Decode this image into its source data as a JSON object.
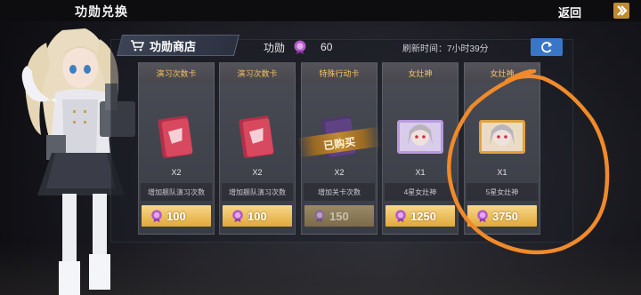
{
  "header": {
    "title": "功勋兑换",
    "back_label": "返回"
  },
  "shop": {
    "tab_label": "功勋商店",
    "merit_label": "功勋",
    "merit_value": "60",
    "refresh_label": "刷新时间：7小时39分"
  },
  "items": [
    {
      "title": "演习次数卡",
      "qty": "X2",
      "desc": "增加舰队演习次数",
      "price": "100",
      "sold": false
    },
    {
      "title": "演习次数卡",
      "qty": "X2",
      "desc": "增加舰队演习次数",
      "price": "100",
      "sold": false
    },
    {
      "title": "特殊行动卡",
      "qty": "X2",
      "desc": "增加关卡次数",
      "price": "150",
      "sold": true,
      "sold_label": "已购买"
    },
    {
      "title": "女灶神",
      "qty": "X1",
      "desc": "4星女灶神",
      "price": "1250",
      "sold": false
    },
    {
      "title": "女灶神",
      "qty": "X1",
      "desc": "5星女灶神",
      "price": "3750",
      "sold": false
    }
  ],
  "colors": {
    "accent_gold": "#e2a83a",
    "title_gold": "#f3c062",
    "annotation": "#f08a2a",
    "refresh_blue": "#3a76c8"
  },
  "icons": {
    "cart": "cart-icon",
    "merit": "merit-medal-icon",
    "refresh": "refresh-icon",
    "back": "chevron-right-icon"
  }
}
